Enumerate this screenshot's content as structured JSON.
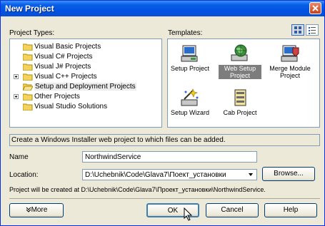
{
  "window": {
    "title": "New Project"
  },
  "labels": {
    "project_types": "Project Types:",
    "templates": "Templates:",
    "name": "Name",
    "location": "Location:"
  },
  "project_types": [
    {
      "label": "Visual Basic Projects",
      "expandable": false
    },
    {
      "label": "Visual C# Projects",
      "expandable": false
    },
    {
      "label": "Visual J# Projects",
      "expandable": false
    },
    {
      "label": "Visual C++ Projects",
      "expandable": true
    },
    {
      "label": "Setup and Deployment Projects",
      "expandable": false,
      "selected": true
    },
    {
      "label": "Other Projects",
      "expandable": true
    },
    {
      "label": "Visual Studio Solutions",
      "expandable": false
    }
  ],
  "templates": [
    {
      "label": "Setup Project",
      "icon": "setup-project-icon"
    },
    {
      "label": "Web Setup Project",
      "icon": "web-setup-project-icon",
      "selected": true
    },
    {
      "label": "Merge Module Project",
      "icon": "merge-module-project-icon"
    },
    {
      "label": "Setup Wizard",
      "icon": "setup-wizard-icon"
    },
    {
      "label": "Cab Project",
      "icon": "cab-project-icon"
    }
  ],
  "description": "Create a Windows Installer web project to which files can be added.",
  "fields": {
    "name_value": "NorthwindService",
    "location_value": "D:\\Uchebnik\\Code\\Glava7\\Поект_установки"
  },
  "info": "Project will be created at D:\\Uchebnik\\Code\\Glava7\\Проект_установки\\NorthwindService.",
  "buttons": {
    "browse": "Browse...",
    "more": "More",
    "ok": "OK",
    "cancel": "Cancel",
    "help": "Help"
  },
  "colors": {
    "titlebar": "#0054e3",
    "dialog_bg": "#ece9d8",
    "selection": "#7d7d7d"
  }
}
